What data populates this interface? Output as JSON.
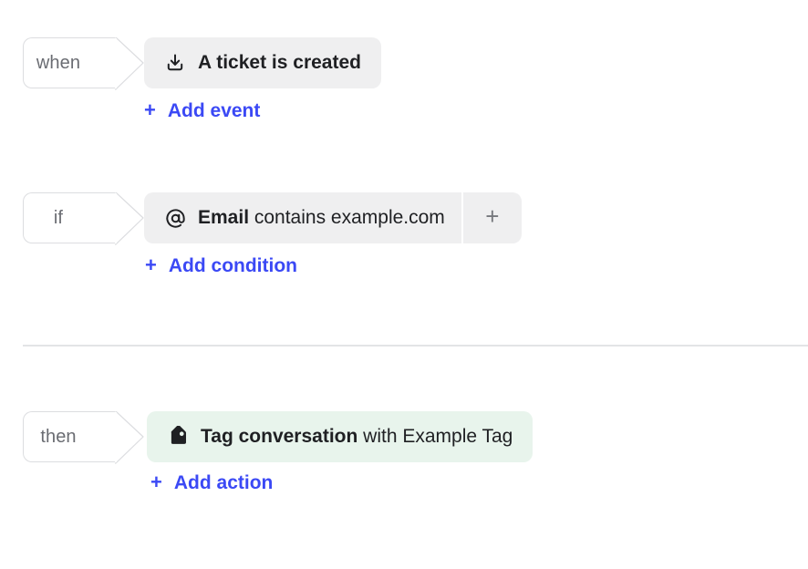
{
  "rule_builder": {
    "rows": [
      {
        "id": "when",
        "chip_label": "when",
        "statement": {
          "icon": "download-tray-icon",
          "text_strong": "A ticket is created",
          "text_rest": "",
          "variant": "grey",
          "has_plus": false
        },
        "add_link": {
          "plus": "+",
          "label": "Add event"
        }
      },
      {
        "id": "if",
        "chip_label": "if",
        "statement": {
          "icon": "at-sign-icon",
          "text_strong": "Email",
          "text_rest": " contains example.com",
          "variant": "grey",
          "has_plus": true,
          "plus_glyph": "+"
        },
        "add_link": {
          "plus": "+",
          "label": "Add condition"
        }
      },
      {
        "id": "then",
        "chip_label": "then",
        "statement": {
          "icon": "tag-icon",
          "text_strong": "Tag conversation",
          "text_rest": " with Example Tag",
          "variant": "green",
          "has_plus": false
        },
        "add_link": {
          "plus": "+",
          "label": "Add action"
        }
      }
    ],
    "colors": {
      "link_blue": "#3b49f5",
      "pill_grey": "#efeff0",
      "pill_green": "#e8f4ec",
      "chip_border": "#dcdde0",
      "chip_text": "#6a6c72",
      "divider": "#e3e4e6",
      "text": "#1f2023",
      "plus_grey": "#76787d"
    }
  }
}
